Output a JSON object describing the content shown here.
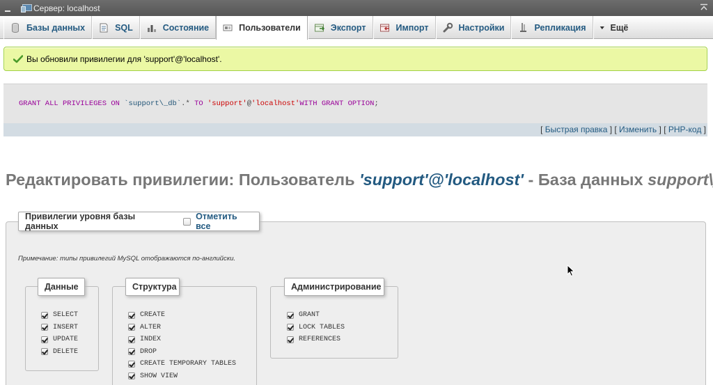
{
  "window": {
    "title": "Сервер: localhost"
  },
  "menu": {
    "tabs": [
      {
        "label": "Базы данных",
        "icon": "database-icon"
      },
      {
        "label": "SQL",
        "icon": "sql-icon"
      },
      {
        "label": "Состояние",
        "icon": "status-icon"
      },
      {
        "label": "Пользователи",
        "icon": "users-icon",
        "active": true
      },
      {
        "label": "Экспорт",
        "icon": "export-icon"
      },
      {
        "label": "Импорт",
        "icon": "import-icon"
      },
      {
        "label": "Настройки",
        "icon": "wrench-icon"
      },
      {
        "label": "Репликация",
        "icon": "replication-icon"
      },
      {
        "label": "Ещё",
        "icon": "caret-down-icon"
      }
    ]
  },
  "message": {
    "text": "Вы обновили привилегии для 'support'@'localhost'."
  },
  "sql": {
    "kw1": "GRANT ALL PRIVILEGES ON ",
    "db": "`support\\_db`",
    "mid": ".* ",
    "kw2": "TO ",
    "user": "'support'",
    "at": "@",
    "host": "'localhost'",
    "kw3": "WITH GRANT OPTION",
    "end": ";"
  },
  "toolbar": {
    "quick_edit": "Быстрая правка",
    "edit": "Изменить",
    "php_code": "PHP-код"
  },
  "heading": {
    "prefix": "Редактировать привилегии: Пользователь ",
    "user": "'support'@'localhost'",
    "middle": " - База данных ",
    "db": "support\\_db"
  },
  "privileges": {
    "legend": "Привилегии уровня базы данных",
    "check_all": "Отметить все",
    "note": "Примечание: типы привилегий MySQL отображаются по-английски.",
    "groups": {
      "data": {
        "title": "Данные",
        "items": [
          "SELECT",
          "INSERT",
          "UPDATE",
          "DELETE"
        ]
      },
      "structure": {
        "title": "Структура",
        "items": [
          "CREATE",
          "ALTER",
          "INDEX",
          "DROP",
          "CREATE TEMPORARY TABLES",
          "SHOW VIEW"
        ]
      },
      "admin": {
        "title": "Администрирование",
        "items": [
          "GRANT",
          "LOCK TABLES",
          "REFERENCES"
        ]
      }
    }
  },
  "colors": {
    "link": "#235a81",
    "success_bg": "#ebf8a4",
    "success_border": "#a2d246",
    "titlebar": "#5f5f5f"
  }
}
